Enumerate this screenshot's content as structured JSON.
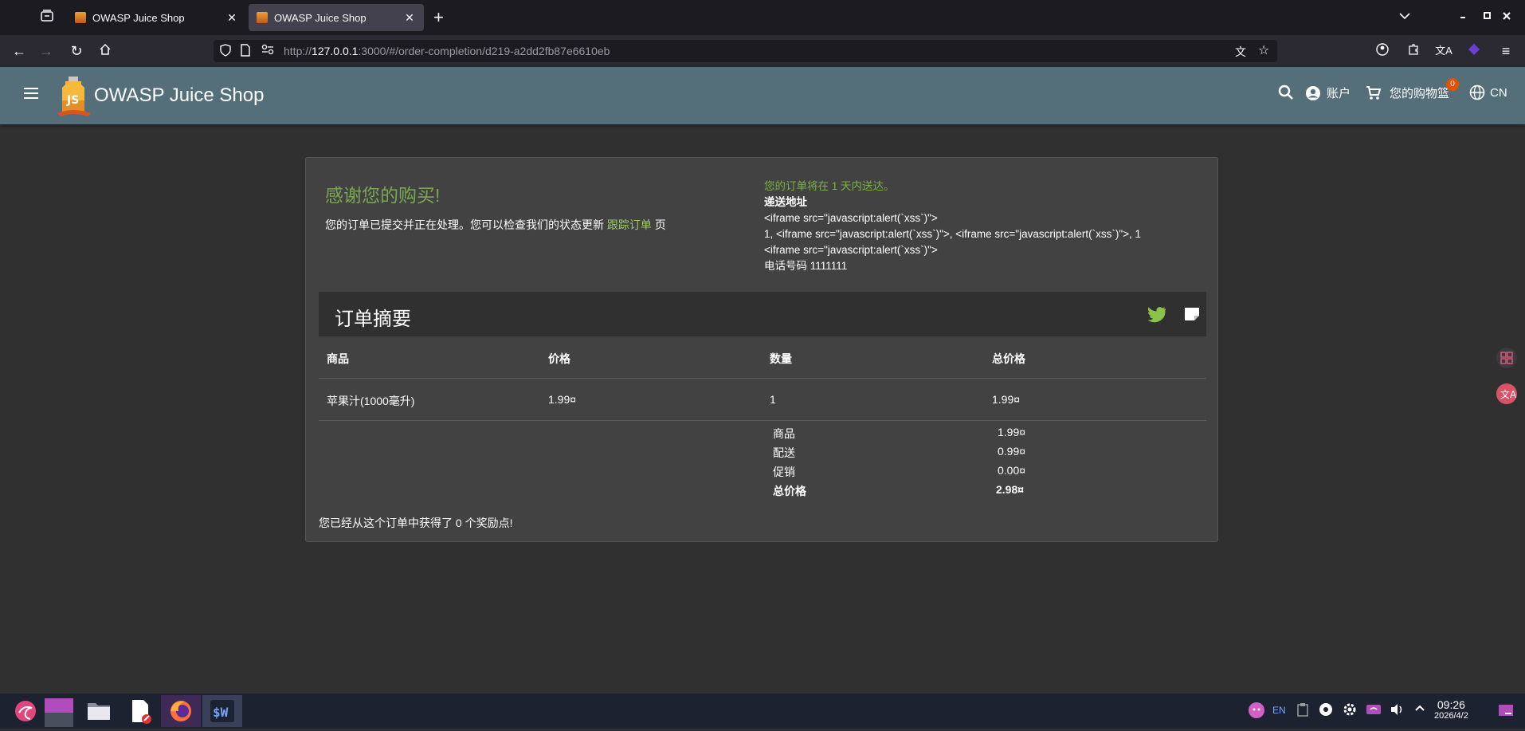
{
  "browser": {
    "tabs": [
      {
        "title": "OWASP Juice Shop",
        "active": false
      },
      {
        "title": "OWASP Juice Shop",
        "active": true
      }
    ],
    "url_prefix": "http://",
    "url_host": "127.0.0.1",
    "url_rest": ":3000/#/order-completion/d219-a2dd2fb87e6610eb"
  },
  "app": {
    "title": "OWASP Juice Shop",
    "account_label": "账户",
    "basket_label": "您的购物篮",
    "basket_count": "0",
    "language": "CN"
  },
  "confirmation": {
    "heading": "感谢您的购买!",
    "message": "您的订单已提交并正在处理。您可以检查我们的状态更新",
    "track_link": "跟踪订单",
    "suffix": " 页",
    "delivery_note": "您的订单将在 1 天内送达。",
    "address_label": "递送地址",
    "address_lines": [
      "<iframe src=\"javascript:alert(`xss`)\">",
      "1, <iframe src=\"javascript:alert(`xss`)\">, <iframe src=\"javascript:alert(`xss`)\">, 1",
      "<iframe src=\"javascript:alert(`xss`)\">"
    ],
    "phone": "电话号码 1111111"
  },
  "summary": {
    "title": "订单摘要",
    "columns": [
      "商品",
      "价格",
      "数量",
      "总价格"
    ],
    "rows": [
      {
        "product": "苹果汁(1000毫升)",
        "price": "1.99¤",
        "qty": "1",
        "total": "1.99¤"
      }
    ],
    "totals": [
      {
        "label": "商品",
        "value": "1.99¤",
        "bold": false
      },
      {
        "label": "配送",
        "value": "0.99¤",
        "bold": false
      },
      {
        "label": "促销",
        "value": "0.00¤",
        "bold": false
      },
      {
        "label": "总价格",
        "value": "2.98¤",
        "bold": true
      }
    ],
    "points_text": "您已经从这个订单中获得了 0 个奖励点!"
  },
  "taskbar": {
    "lang_indicator": "EN",
    "time": "09:26",
    "date": "2026/4/2"
  }
}
